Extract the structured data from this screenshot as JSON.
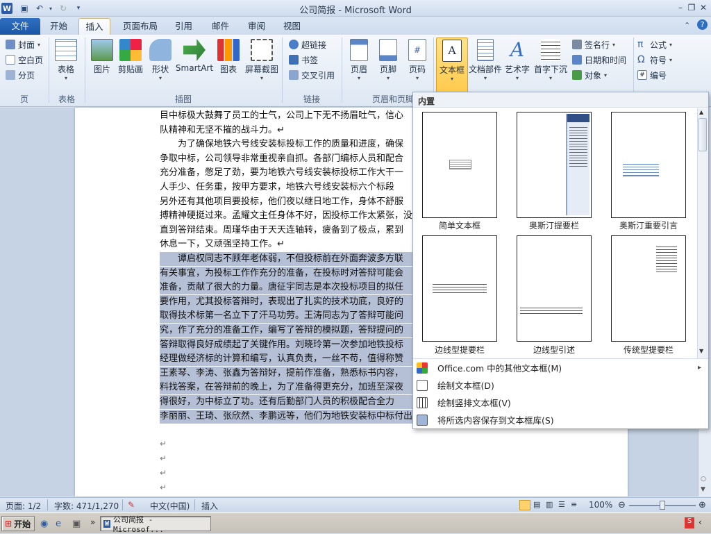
{
  "window": {
    "title": "公司简报 - Microsoft Word"
  },
  "tabs": [
    "文件",
    "开始",
    "插入",
    "页面布局",
    "引用",
    "邮件",
    "审阅",
    "视图"
  ],
  "ribbon": {
    "page_group": {
      "label": "页",
      "items": [
        "封面",
        "空白页",
        "分页"
      ]
    },
    "table_group": {
      "label": "表格",
      "button": "表格"
    },
    "illus_group": {
      "label": "插图",
      "buttons": [
        "图片",
        "剪贴画",
        "形状",
        "SmartArt",
        "图表",
        "屏幕截图"
      ]
    },
    "links_group": {
      "label": "链接",
      "items": [
        "超链接",
        "书签",
        "交叉引用"
      ]
    },
    "hf_group": {
      "label": "页眉和页脚",
      "buttons": [
        "页眉",
        "页脚",
        "页码"
      ]
    },
    "text_group": {
      "buttons": [
        "文本框",
        "文档部件",
        "艺术字",
        "首字下沉"
      ],
      "items": [
        "签名行",
        "日期和时间",
        "对象"
      ]
    },
    "symbols_group": {
      "items": [
        "公式",
        "符号",
        "编号"
      ]
    }
  },
  "document": {
    "lines": [
      {
        "text": "目中标极大鼓舞了员工的士气，公司上下无不扬眉吐气，信心",
        "selected": false
      },
      {
        "text": "队精神和无坚不摧的战斗力。↵",
        "selected": false
      },
      {
        "text": "　　为了确保地铁六号线安装标投标工作的质量和进度，确保",
        "selected": false
      },
      {
        "text": "争取中标，公司领导非常重视亲自抓。各部门编标人员和配合",
        "selected": false
      },
      {
        "text": "充分准备，憋足了劲，要为地铁六号线安装标投标工作大干一",
        "selected": false
      },
      {
        "text": "人手少、任务重，按甲方要求，地铁六号线安装标六个标段",
        "selected": false
      },
      {
        "text": "另外还有其他项目要投标，他们夜以继日地工作，身体不舒服",
        "selected": false
      },
      {
        "text": "搏精神硬挺过来。孟耀文主任身体不好，因投标工作太紧张，没",
        "selected": false
      },
      {
        "text": "直到答辩结束。周瑾华由于天天连轴转，疲备到了极点，累到",
        "selected": false
      },
      {
        "text": "休息一下，又顽强坚持工作。↵",
        "selected": false
      },
      {
        "text": "　　谭启权同志不顾年老体弱，不但投标前在外面奔波多方联",
        "selected": true
      },
      {
        "text": "有关事宜，为投标工作作充分的准备，在投标时对答辩可能会",
        "selected": true
      },
      {
        "text": "准备，贡献了很大的力量。唐征宇同志是本次投标项目的拟任",
        "selected": true
      },
      {
        "text": "要作用，尤其投标答辩时，表现出了扎实的技术功底，良好的",
        "selected": true
      },
      {
        "text": "取得技术标第一名立下了汗马功劳。王涛同志为了答辩可能问",
        "selected": true
      },
      {
        "text": "究，作了充分的准备工作，编写了答辩的模拟题，答辩提问的",
        "selected": true
      },
      {
        "text": "答辩取得良好成绩起了关键作用。刘晓玲第一次参加地铁投标",
        "selected": true
      },
      {
        "text": "经理做经济标的计算和编写，认真负责，一丝不苟，值得称赞",
        "selected": true
      },
      {
        "text": "王素琴、李涛、张鑫为答辩好，提前作准备，熟悉标书内容，",
        "selected": true
      },
      {
        "text": "料找答案，在答辩前的晚上，为了准备得更充分，加班至深夜",
        "selected": true
      },
      {
        "text": "得很好，为中标立了功。还有后勤部门人员的积极配合全力",
        "selected": true
      },
      {
        "text": "李丽丽、王琦、张欣然、李鹏远等，他们为地铁安装标中标付出了很大的努力。↵",
        "selected": true
      }
    ],
    "paragraph_mark": "↵"
  },
  "panel": {
    "header": "内置",
    "thumbnails": [
      "简单文本框",
      "奥斯汀提要栏",
      "奥斯汀重要引言",
      "边线型提要栏",
      "边线型引述",
      "传统型提要栏"
    ],
    "menu": [
      {
        "label": "Office.com 中的其他文本框(M)",
        "arrow": "▸"
      },
      {
        "label": "绘制文本框(D)"
      },
      {
        "label": "绘制竖排文本框(V)"
      },
      {
        "label": "将所选内容保存到文本框库(S)"
      }
    ]
  },
  "status": {
    "page": "页面: 1/2",
    "words": "字数: 471/1,270",
    "language": "中文(中国)",
    "mode": "插入",
    "zoom": "100%"
  },
  "taskbar": {
    "start": "开始",
    "task": "公司简报 - Microsof..."
  }
}
